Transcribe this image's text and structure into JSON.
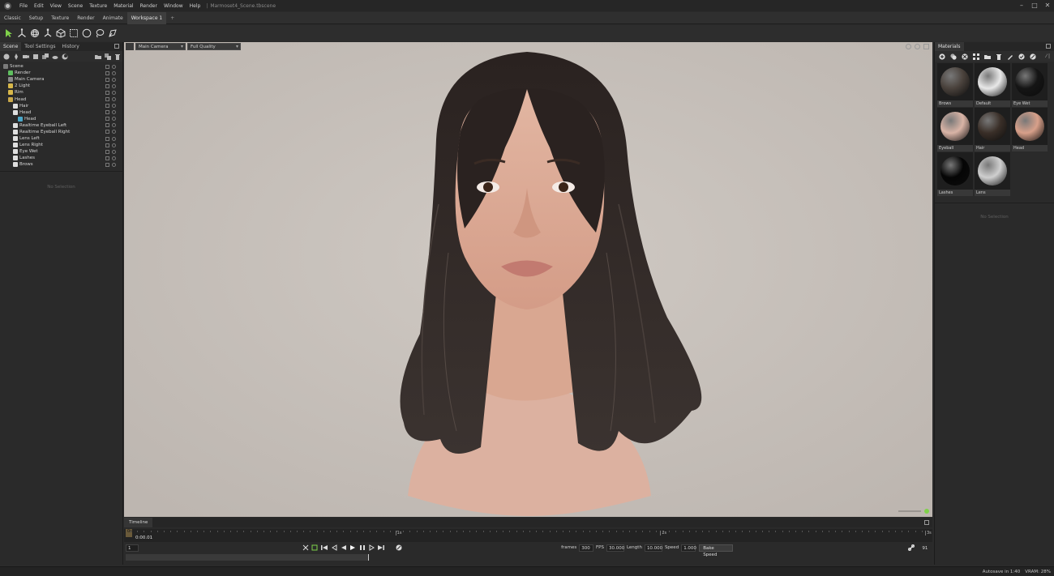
{
  "app": {
    "menus": [
      "File",
      "Edit",
      "View",
      "Scene",
      "Texture",
      "Material",
      "Render",
      "Window",
      "Help"
    ],
    "window_title": "Marmoset4_Scene.tbscene"
  },
  "workspace_tabs": [
    {
      "label": "Classic"
    },
    {
      "label": "Setup"
    },
    {
      "label": "Texture"
    },
    {
      "label": "Render"
    },
    {
      "label": "Animate"
    },
    {
      "label": "Workspace 1"
    },
    {
      "label": "+"
    }
  ],
  "tools": [
    "select-arrow-icon",
    "move-gizmo-icon",
    "rotate-gizmo-icon",
    "scale-gizmo-icon",
    "transform-icon",
    "box-select-icon",
    "circle-select-icon",
    "lasso-icon",
    "paint-select-icon"
  ],
  "left_panel": {
    "tabs": [
      "Scene",
      "Tool Settings",
      "History"
    ],
    "tree": [
      {
        "label": "Scene",
        "indent": 0,
        "color": "#7a7a7a"
      },
      {
        "label": "Render",
        "indent": 1,
        "color": "#5fbf5f"
      },
      {
        "label": "Main Camera",
        "indent": 1,
        "color": "#8a8a8a"
      },
      {
        "label": "2 Light",
        "indent": 1,
        "color": "#d8b84a"
      },
      {
        "label": "Rim",
        "indent": 1,
        "color": "#d8b84a"
      },
      {
        "label": "Head",
        "indent": 1,
        "color": "#c9a84a"
      },
      {
        "label": "Hair",
        "indent": 2,
        "color": "#dedede"
      },
      {
        "label": "Head",
        "indent": 2,
        "color": "#dedede"
      },
      {
        "label": "Head",
        "indent": 3,
        "color": "#4aa7c9"
      },
      {
        "label": "Realtime Eyeball Left",
        "indent": 2,
        "color": "#dedede"
      },
      {
        "label": "Realtime Eyeball Right",
        "indent": 2,
        "color": "#dedede"
      },
      {
        "label": "Lens Left",
        "indent": 2,
        "color": "#dedede"
      },
      {
        "label": "Lens Right",
        "indent": 2,
        "color": "#dedede"
      },
      {
        "label": "Eye Wet",
        "indent": 2,
        "color": "#dedede"
      },
      {
        "label": "Lashes",
        "indent": 2,
        "color": "#dedede"
      },
      {
        "label": "Brows",
        "indent": 2,
        "color": "#dedede"
      }
    ],
    "no_selection": "No Selection"
  },
  "viewport": {
    "camera": "Main Camera",
    "quality": "Full Quality"
  },
  "right_panel": {
    "tab": "Materials",
    "materials": [
      {
        "name": "Brows",
        "color": "#4a423c"
      },
      {
        "name": "Default",
        "color": "#e8e8e8"
      },
      {
        "name": "Eye Wet",
        "color": "#151515"
      },
      {
        "name": "Eyeball",
        "color": "#d9b4a6"
      },
      {
        "name": "Hair",
        "color": "#3a2f28"
      },
      {
        "name": "Head",
        "color": "#d8a08a"
      },
      {
        "name": "Lashes",
        "color": "#050505"
      },
      {
        "name": "Lens",
        "color": "#cfcfcf"
      }
    ],
    "no_selection": "No Selection"
  },
  "timeline": {
    "tab": "Timeline",
    "time": "0:00.01",
    "start_mark": "0s",
    "marks": [
      {
        "label": "1s"
      },
      {
        "label": "2s"
      },
      {
        "label": "3s"
      }
    ],
    "frame_field": "1",
    "frames_label": "frames",
    "frames": "300",
    "fps_label": "FPS",
    "fps": "30.000",
    "length_label": "Length",
    "length": "10.000",
    "speed_label": "Speed",
    "speed": "1.000",
    "bake_speed": "Bake Speed",
    "keys_count": "91"
  },
  "status": {
    "autosave": "Autosave in 1:40",
    "vram": "VRAM: 28%"
  }
}
